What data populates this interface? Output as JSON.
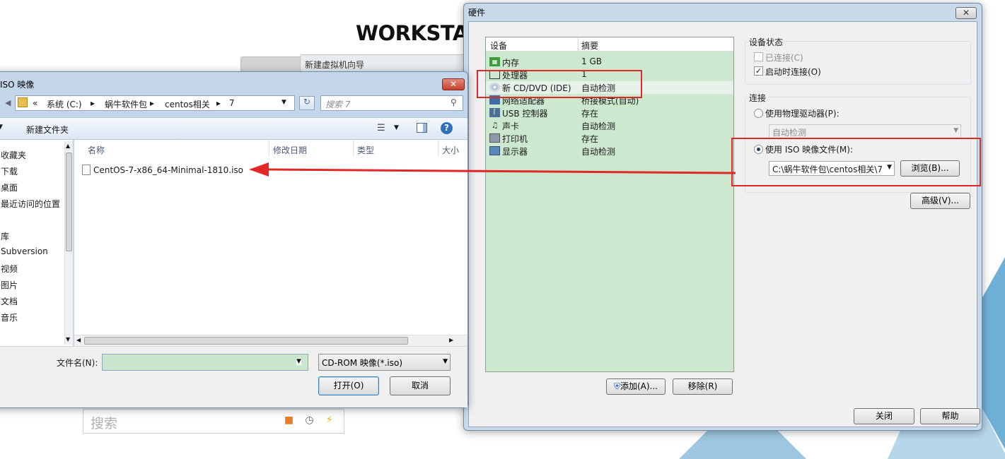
{
  "background": {
    "brand_title": "WORKSTA",
    "wizard_tab": "新建虚拟机向导",
    "search_placeholder": "搜索"
  },
  "hardware_dialog": {
    "title": "硬件",
    "list_headers": {
      "device": "设备",
      "summary": "摘要"
    },
    "devices": [
      {
        "icon": "memory-icon",
        "name": "内存",
        "summary": "1 GB"
      },
      {
        "icon": "cpu-icon",
        "name": "处理器",
        "summary": "1"
      },
      {
        "icon": "cd-dvd-icon",
        "name": "新 CD/DVD (IDE)",
        "summary": "自动检测"
      },
      {
        "icon": "network-adapter-icon",
        "name": "网络适配器",
        "summary": "桥接模式(自动)"
      },
      {
        "icon": "usb-icon",
        "name": "USB 控制器",
        "summary": "存在"
      },
      {
        "icon": "sound-card-icon",
        "name": "声卡",
        "summary": "自动检测"
      },
      {
        "icon": "printer-icon",
        "name": "打印机",
        "summary": "存在"
      },
      {
        "icon": "display-icon",
        "name": "显示器",
        "summary": "自动检测"
      }
    ],
    "device_status": {
      "group_label": "设备状态",
      "connected_label": "已连接(C)",
      "connected_checked": false,
      "connect_at_poweron_label": "启动时连接(O)",
      "connect_at_poweron_checked": true
    },
    "connection": {
      "group_label": "连接",
      "physical_drive_label": "使用物理驱动器(P):",
      "physical_drive_value": "自动检测",
      "iso_label": "使用 ISO 映像文件(M):",
      "iso_path_value": "C:\\蜗牛软件包\\centos相关\\7",
      "browse_button": "浏览(B)...",
      "selected_option": "iso"
    },
    "advanced_button": "高级(V)...",
    "add_button": "添加(A)...",
    "remove_button": "移除(R)",
    "close_button": "关闭",
    "help_button": "帮助"
  },
  "iso_dialog": {
    "title": "ISO 映像",
    "breadcrumb": [
      "«",
      "系统 (C:)",
      "蜗牛软件包",
      "centos相关",
      "7"
    ],
    "search_placeholder": "搜索 7",
    "new_folder_button": "新建文件夹",
    "nav_items": [
      "收藏夹",
      "下载",
      "桌面",
      "最近访问的位置",
      "库",
      "Subversion",
      "视频",
      "图片",
      "文档",
      "音乐"
    ],
    "columns": [
      "名称",
      "修改日期",
      "类型",
      "大小"
    ],
    "files": [
      {
        "name": "CentOS-7-x86_64-Minimal-1810.iso"
      }
    ],
    "filename_label": "文件名(N):",
    "filename_value": "",
    "filetype_value": "CD-ROM 映像(*.iso)",
    "open_button": "打开(O)",
    "cancel_button": "取消"
  },
  "colors": {
    "annotation_red": "#e02828",
    "device_list_bg": "#cce8cf"
  }
}
